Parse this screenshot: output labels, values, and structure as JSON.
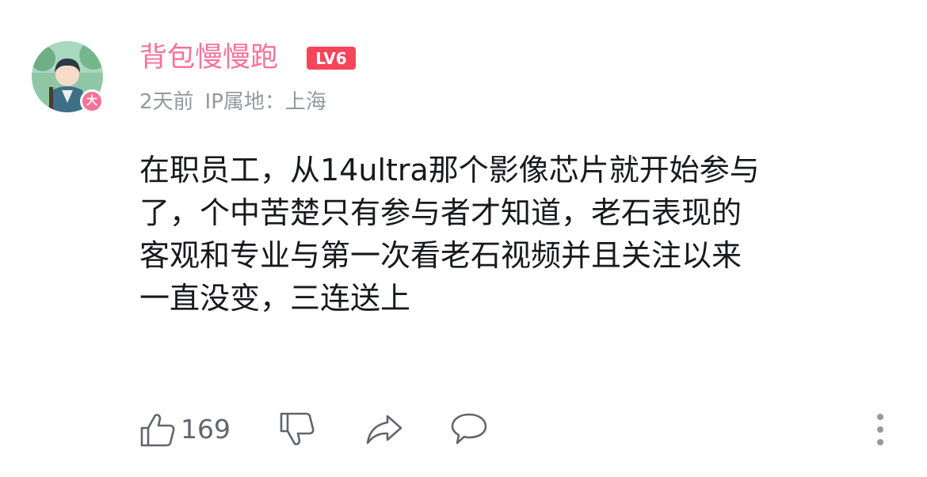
{
  "comment": {
    "author": {
      "name": "背包慢慢跑",
      "level_badge": "LV6",
      "avatar_badge": "大"
    },
    "meta": {
      "time": "2天前",
      "location": "IP属地：上海"
    },
    "text_lines": [
      "在职员工，从14ultra那个影像芯片就开始参与",
      "了，个中苦楚只有参与者才知道，老石表现的",
      "客观和专业与第一次看老石视频并且关注以来",
      "一直没变，三连送上"
    ],
    "actions": {
      "like_count": "169"
    }
  },
  "icons": {
    "avatar": "avatar-image",
    "like": "thumbs-up-icon",
    "dislike": "thumbs-down-icon",
    "share": "share-arrow-icon",
    "reply": "speech-bubble-icon",
    "more": "vertical-dots-icon"
  },
  "colors": {
    "username": "#fb7299",
    "level_badge": "#f6455b",
    "avatar_badge": "#fb7299",
    "meta_text": "#9499a0",
    "body_text": "#18191c",
    "action_icon": "#61666d"
  }
}
